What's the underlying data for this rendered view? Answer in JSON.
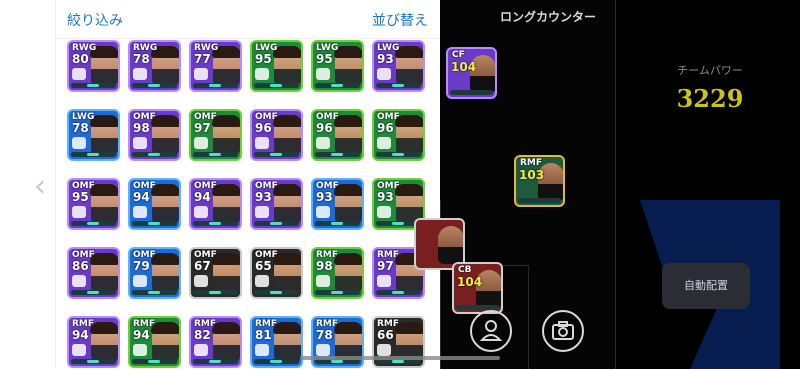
{
  "panel": {
    "filter_label": "絞り込み",
    "sort_label": "並び替え"
  },
  "nav": {
    "back_icon": "chevron-left-icon"
  },
  "player_cards": [
    {
      "pos": "RWG",
      "ovr": "80",
      "bg": "#6a3bc8",
      "border": "#b68cff"
    },
    {
      "pos": "RWG",
      "ovr": "78",
      "bg": "#6a3bc8",
      "border": "#b68cff"
    },
    {
      "pos": "RWG",
      "ovr": "77",
      "bg": "#6a3bc8",
      "border": "#b68cff"
    },
    {
      "pos": "LWG",
      "ovr": "95",
      "bg": "#1f8a3a",
      "border": "#6fd13a"
    },
    {
      "pos": "LWG",
      "ovr": "95",
      "bg": "#1f8a3a",
      "border": "#6fd13a"
    },
    {
      "pos": "LWG",
      "ovr": "93",
      "bg": "#6a3bc8",
      "border": "#b68cff"
    },
    {
      "pos": "LWG",
      "ovr": "78",
      "bg": "#1f6bd6",
      "border": "#5fb0ff"
    },
    {
      "pos": "OMF",
      "ovr": "98",
      "bg": "#6a3bc8",
      "border": "#b68cff"
    },
    {
      "pos": "OMF",
      "ovr": "97",
      "bg": "#1f8a3a",
      "border": "#6fd13a"
    },
    {
      "pos": "OMF",
      "ovr": "96",
      "bg": "#6a3bc8",
      "border": "#b68cff"
    },
    {
      "pos": "OMF",
      "ovr": "96",
      "bg": "#1f8a3a",
      "border": "#6fd13a"
    },
    {
      "pos": "OMF",
      "ovr": "96",
      "bg": "#1f8a3a",
      "border": "#6fd13a"
    },
    {
      "pos": "OMF",
      "ovr": "95",
      "bg": "#6a3bc8",
      "border": "#b68cff"
    },
    {
      "pos": "OMF",
      "ovr": "94",
      "bg": "#1f6bd6",
      "border": "#5fb0ff"
    },
    {
      "pos": "OMF",
      "ovr": "94",
      "bg": "#6a3bc8",
      "border": "#b68cff"
    },
    {
      "pos": "OMF",
      "ovr": "93",
      "bg": "#6a3bc8",
      "border": "#b68cff"
    },
    {
      "pos": "OMF",
      "ovr": "93",
      "bg": "#1f6bd6",
      "border": "#5fb0ff"
    },
    {
      "pos": "OMF",
      "ovr": "93",
      "bg": "#1f8a3a",
      "border": "#6fd13a"
    },
    {
      "pos": "OMF",
      "ovr": "86",
      "bg": "#6a3bc8",
      "border": "#b68cff"
    },
    {
      "pos": "OMF",
      "ovr": "79",
      "bg": "#1f6bd6",
      "border": "#5fb0ff"
    },
    {
      "pos": "OMF",
      "ovr": "67",
      "bg": "#2a2a2a",
      "border": "#c9c9c9"
    },
    {
      "pos": "OMF",
      "ovr": "65",
      "bg": "#2a2a2a",
      "border": "#c9c9c9"
    },
    {
      "pos": "RMF",
      "ovr": "98",
      "bg": "#1f8a3a",
      "border": "#6fd13a"
    },
    {
      "pos": "RMF",
      "ovr": "97",
      "bg": "#6a3bc8",
      "border": "#b68cff"
    },
    {
      "pos": "RMF",
      "ovr": "94",
      "bg": "#6a3bc8",
      "border": "#b68cff"
    },
    {
      "pos": "RMF",
      "ovr": "94",
      "bg": "#1f8a3a",
      "border": "#6fd13a"
    },
    {
      "pos": "RMF",
      "ovr": "82",
      "bg": "#6a3bc8",
      "border": "#b68cff"
    },
    {
      "pos": "RMF",
      "ovr": "81",
      "bg": "#1f6bd6",
      "border": "#5fb0ff"
    },
    {
      "pos": "RMF",
      "ovr": "78",
      "bg": "#1f6bd6",
      "border": "#5fb0ff"
    },
    {
      "pos": "RMF",
      "ovr": "66",
      "bg": "#2a2a2a",
      "border": "#c9c9c9"
    }
  ],
  "formation": {
    "title": "ロングカウンター",
    "pitch_players": [
      {
        "pos": "CF",
        "ovr": "104"
      },
      {
        "pos": "RMF",
        "ovr": "103"
      },
      {
        "pos": "CB",
        "ovr": "104"
      }
    ]
  },
  "team_power": {
    "label": "チームパワー",
    "value": "3229"
  },
  "buttons": {
    "auto_assign": "自動配置",
    "profile_icon": "person-icon",
    "camera_icon": "camera-icon"
  },
  "colors": {
    "accent_link": "#1a77c9",
    "team_power_value": "#c7c51a"
  }
}
